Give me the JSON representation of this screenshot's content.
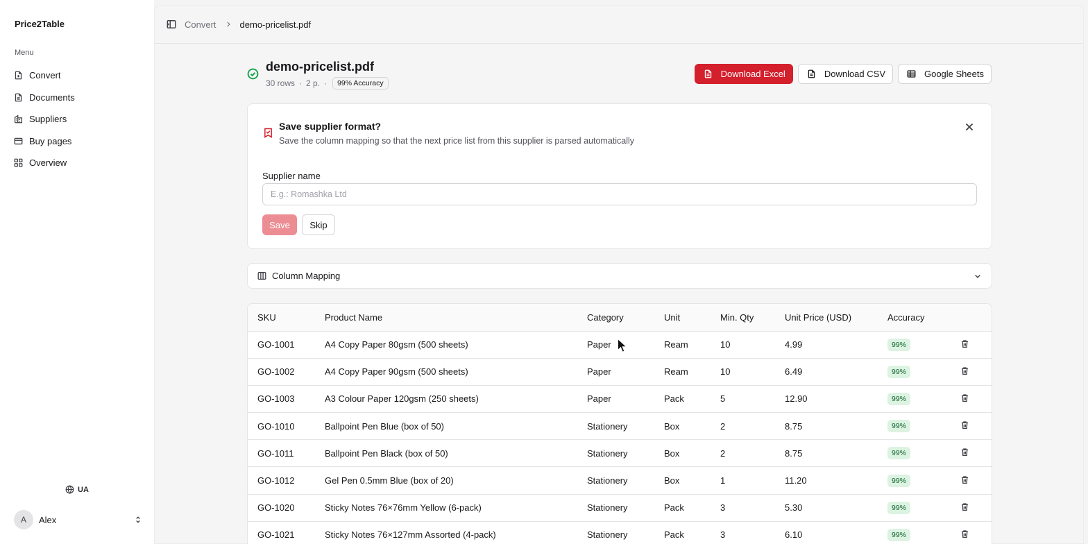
{
  "sidebar": {
    "brand": "Price2Table",
    "menu_label": "Menu",
    "items": [
      {
        "label": "Convert",
        "icon": "file-plus-icon"
      },
      {
        "label": "Documents",
        "icon": "file-text-icon"
      },
      {
        "label": "Suppliers",
        "icon": "building-icon"
      },
      {
        "label": "Buy pages",
        "icon": "credit-card-icon"
      },
      {
        "label": "Overview",
        "icon": "grid-icon"
      }
    ],
    "language": "UA",
    "user": {
      "initial": "A",
      "name": "Alex"
    }
  },
  "breadcrumb": {
    "parent": "Convert",
    "current": "demo-pricelist.pdf"
  },
  "file": {
    "title": "demo-pricelist.pdf",
    "rows": "30 rows",
    "pages": "2 p.",
    "accuracy": "99% Accuracy"
  },
  "actions": {
    "download_excel": "Download Excel",
    "download_csv": "Download CSV",
    "google_sheets": "Google Sheets"
  },
  "save_format": {
    "title": "Save supplier format?",
    "description": "Save the column mapping so that the next price list from this supplier is parsed automatically",
    "field_label": "Supplier name",
    "placeholder": "E.g.: Romashka Ltd",
    "value": "",
    "save_label": "Save",
    "skip_label": "Skip"
  },
  "column_mapping": {
    "title": "Column Mapping"
  },
  "table": {
    "headers": [
      "SKU",
      "Product Name",
      "Category",
      "Unit",
      "Min. Qty",
      "Unit Price (USD)",
      "Accuracy"
    ],
    "rows": [
      [
        "GO-1001",
        "A4 Copy Paper 80gsm (500 sheets)",
        "Paper",
        "Ream",
        "10",
        "4.99",
        "99%"
      ],
      [
        "GO-1002",
        "A4 Copy Paper 90gsm (500 sheets)",
        "Paper",
        "Ream",
        "10",
        "6.49",
        "99%"
      ],
      [
        "GO-1003",
        "A3 Colour Paper 120gsm (250 sheets)",
        "Paper",
        "Pack",
        "5",
        "12.90",
        "99%"
      ],
      [
        "GO-1010",
        "Ballpoint Pen Blue (box of 50)",
        "Stationery",
        "Box",
        "2",
        "8.75",
        "99%"
      ],
      [
        "GO-1011",
        "Ballpoint Pen Black (box of 50)",
        "Stationery",
        "Box",
        "2",
        "8.75",
        "99%"
      ],
      [
        "GO-1012",
        "Gel Pen 0.5mm Blue (box of 20)",
        "Stationery",
        "Box",
        "1",
        "11.20",
        "99%"
      ],
      [
        "GO-1020",
        "Sticky Notes 76×76mm Yellow (6-pack)",
        "Stationery",
        "Pack",
        "3",
        "5.30",
        "99%"
      ],
      [
        "GO-1021",
        "Sticky Notes 76×127mm Assorted (4-pack)",
        "Stationery",
        "Pack",
        "3",
        "6.10",
        "99%"
      ]
    ]
  },
  "colors": {
    "accent": "#d41f2c",
    "success": "#16a34a",
    "accuracy_bg": "#dcf3e2"
  }
}
